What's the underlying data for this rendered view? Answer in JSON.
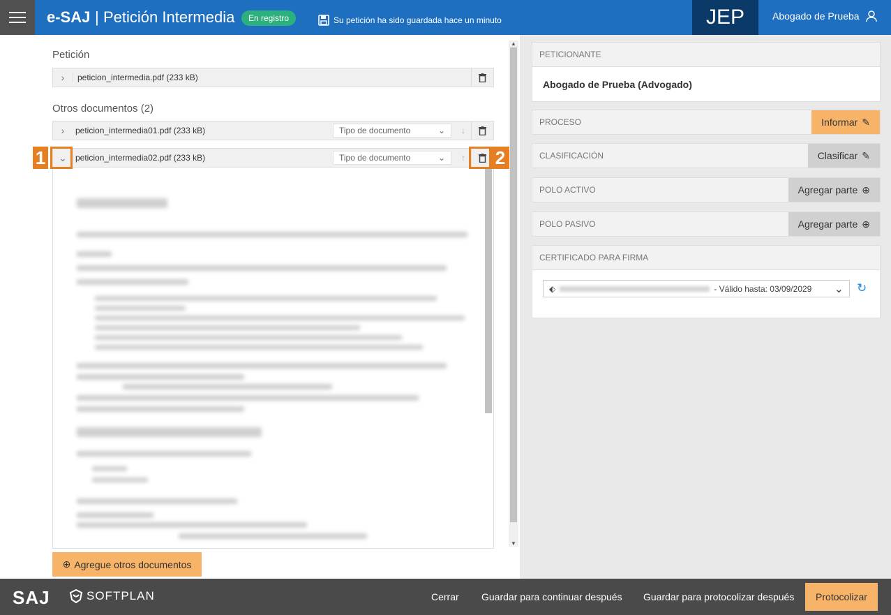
{
  "header": {
    "brand": "e-SAJ",
    "separator": "|",
    "title": "Petición Intermedia",
    "status_badge": "En registro",
    "saved_message": "Su petición ha sido guardada hace un minuto",
    "court": "JEP",
    "user": "Abogado de Prueba"
  },
  "petition": {
    "label": "Petición",
    "file": "peticion_intermedia.pdf (233 kB)"
  },
  "other_docs": {
    "label": "Otros documentos (2)",
    "items": [
      {
        "file": "peticion_intermedia01.pdf (233 kB)",
        "type_placeholder": "Tipo de documento"
      },
      {
        "file": "peticion_intermedia02.pdf (233 kB)",
        "type_placeholder": "Tipo de documento"
      }
    ],
    "add_label": "Agregue otros documentos"
  },
  "markers": {
    "one": "1",
    "two": "2"
  },
  "side": {
    "petitioner_label": "PETICIONANTE",
    "petitioner_value": "Abogado de Prueba (Advogado)",
    "process_label": "PROCESO",
    "process_action": "Informar",
    "classification_label": "CLASIFICACIÓN",
    "classification_action": "Clasificar",
    "active_label": "POLO ACTIVO",
    "active_action": "Agregar parte",
    "passive_label": "POLO PASIVO",
    "passive_action": "Agregar parte",
    "cert_label": "CERTIFICADO PARA FIRMA",
    "cert_valid": "- Válido hasta: 03/09/2029"
  },
  "footer": {
    "logo_saj": "SAJ",
    "logo_softplan": "SOFTPLAN",
    "close": "Cerrar",
    "save_continue": "Guardar para continuar después",
    "save_protocol": "Guardar para protocolizar después",
    "protocol": "Protocolizar"
  },
  "colors": {
    "header_blue": "#1e6fbf",
    "jep_navy": "#0c3a68",
    "accent_orange": "#f7b469",
    "marker_orange": "#e67e22",
    "badge_green": "#2bb07e"
  }
}
